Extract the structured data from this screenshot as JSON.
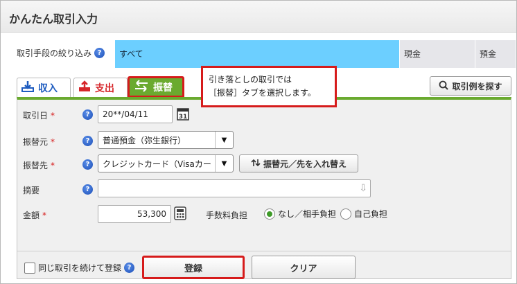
{
  "window": {
    "title": "かんたん取引入力"
  },
  "filter": {
    "label": "取引手段の絞り込み",
    "options": [
      "すべて",
      "現金",
      "預金"
    ]
  },
  "tabs": [
    {
      "label": "収入",
      "icon": "income-icon"
    },
    {
      "label": "支出",
      "icon": "expense-icon"
    },
    {
      "label": "振替",
      "icon": "transfer-icon"
    }
  ],
  "example_button": "取引例を探す",
  "callout": {
    "line1": "引き落としの取引では",
    "line2": "［振替］タブを選択します。"
  },
  "form": {
    "date": {
      "label": "取引日",
      "value": "20**/04/11"
    },
    "from": {
      "label": "振替元",
      "value": "普通預金（弥生銀行）"
    },
    "to": {
      "label": "振替先",
      "value": "クレジットカード（Visaカー"
    },
    "swap_button": "振替元／先を入れ替え",
    "memo": {
      "label": "摘要",
      "value": ""
    },
    "amount": {
      "label": "金額",
      "value": "53,300"
    },
    "fee": {
      "label": "手数料負担",
      "options": [
        "なし／相手負担",
        "自己負担"
      ],
      "selected": "なし／相手負担"
    },
    "required_mark": "*"
  },
  "footer": {
    "continue_label": "同じ取引を続けて登録",
    "register": "登録",
    "clear": "クリア"
  },
  "colors": {
    "accent_blue": "#6ccfff",
    "transfer_green": "#6aaa2f",
    "highlight_red": "#d61b1b"
  }
}
